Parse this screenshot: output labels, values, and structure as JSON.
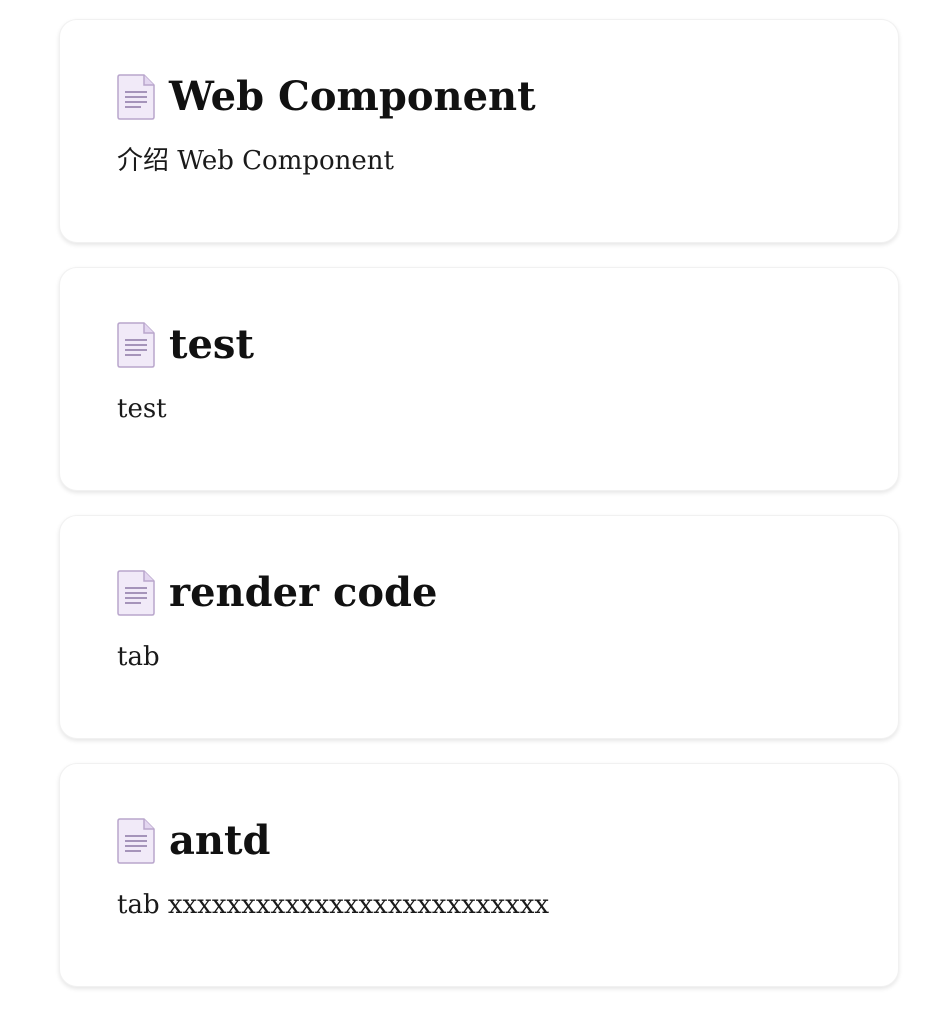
{
  "cards": [
    {
      "title": "Web Component",
      "description": "介绍 Web Component",
      "icon": "document-icon"
    },
    {
      "title": "test",
      "description": "test",
      "icon": "document-icon"
    },
    {
      "title": "render code",
      "description": "tab",
      "icon": "document-icon"
    },
    {
      "title": "antd",
      "description": "tab xxxxxxxxxxxxxxxxxxxxxxxxxx",
      "icon": "document-icon"
    }
  ],
  "colors": {
    "icon_fill": "#f1eaf8",
    "icon_border": "#b9a6cc",
    "icon_lines": "#8c78a6",
    "title_text": "#111111",
    "card_border": "#f1f1f1"
  }
}
